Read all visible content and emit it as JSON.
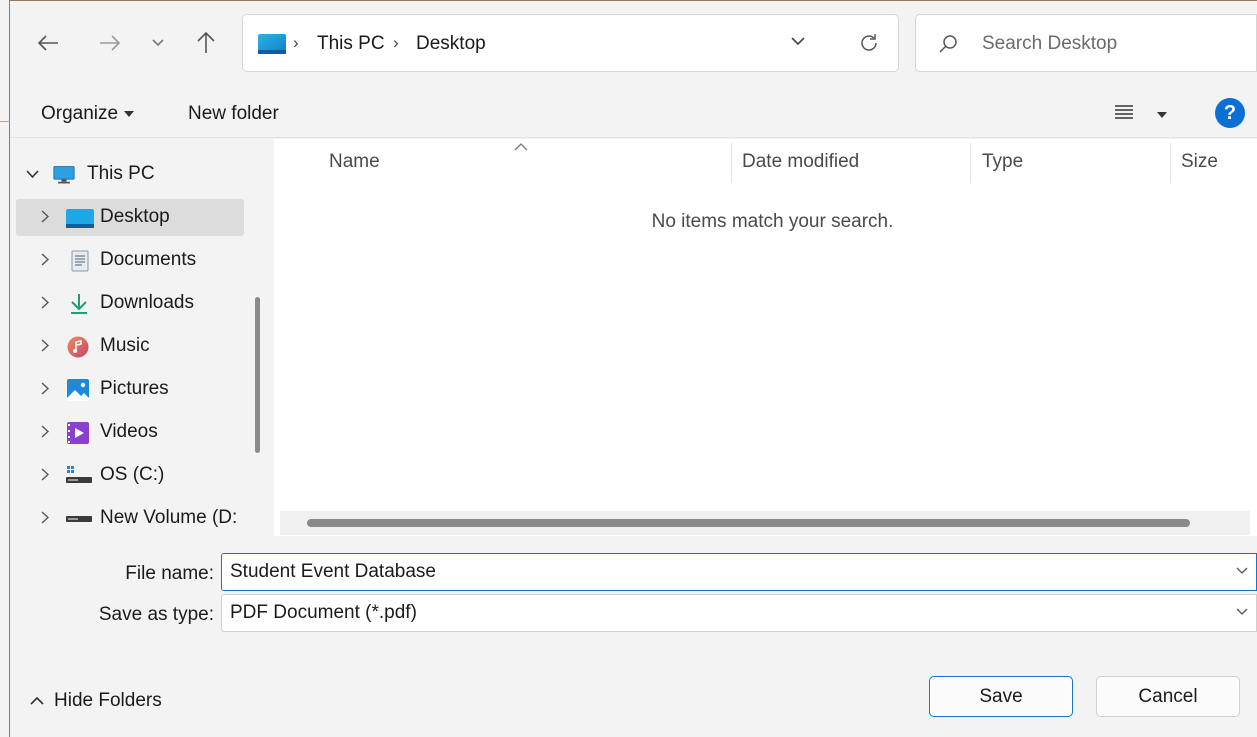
{
  "nav": {
    "back_icon": "arrow-left-icon",
    "forward_icon": "arrow-right-icon",
    "recent_icon": "chevron-down-icon",
    "up_icon": "arrow-up-icon"
  },
  "address": {
    "crumbs": [
      "This PC",
      "Desktop"
    ],
    "icon": "desktop-icon"
  },
  "search": {
    "placeholder": "Search Desktop"
  },
  "toolbar": {
    "organize_label": "Organize",
    "new_folder_label": "New folder"
  },
  "sidebar": {
    "root": {
      "label": "This PC",
      "expanded": true
    },
    "items": [
      {
        "label": "Desktop",
        "icon": "desktop-icon",
        "selected": true
      },
      {
        "label": "Documents",
        "icon": "documents-icon"
      },
      {
        "label": "Downloads",
        "icon": "downloads-icon"
      },
      {
        "label": "Music",
        "icon": "music-icon"
      },
      {
        "label": "Pictures",
        "icon": "pictures-icon"
      },
      {
        "label": "Videos",
        "icon": "videos-icon"
      },
      {
        "label": "OS (C:)",
        "icon": "drive-c-icon"
      },
      {
        "label": "New Volume (D:",
        "icon": "drive-icon"
      }
    ]
  },
  "filelist": {
    "columns": [
      "Name",
      "Date modified",
      "Type",
      "Size"
    ],
    "empty_message": "No items match your search."
  },
  "form": {
    "filename_label": "File name:",
    "filename_value": "Student Event Database",
    "type_label": "Save as type:",
    "type_value": "PDF Document (*.pdf)"
  },
  "footer": {
    "hide_folders_label": "Hide Folders",
    "save_label": "Save",
    "cancel_label": "Cancel"
  },
  "colors": {
    "accent": "#1a73c9",
    "help": "#0b6fd6",
    "selection": "#dcdcdc"
  }
}
